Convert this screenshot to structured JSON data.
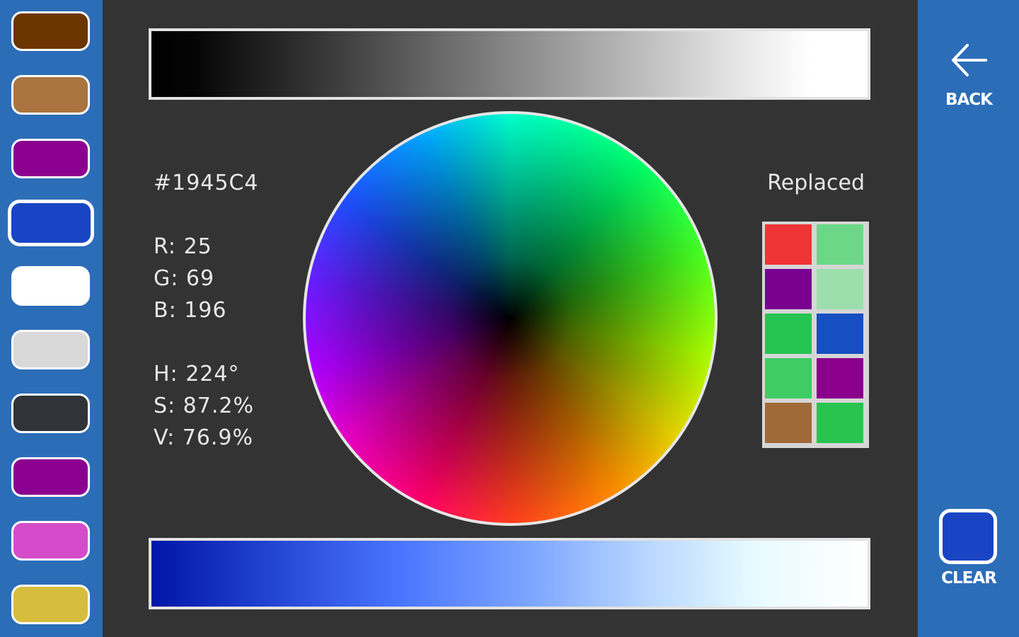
{
  "palette": {
    "swatches": [
      {
        "color": "#6b3500",
        "selected": false
      },
      {
        "color": "#a9743f",
        "selected": false
      },
      {
        "color": "#8b008f",
        "selected": false
      },
      {
        "color": "#1945c4",
        "selected": true
      },
      {
        "color": "#ffffff",
        "selected": false
      },
      {
        "color": "#d8d8d8",
        "selected": false
      },
      {
        "color": "#303438",
        "selected": false
      },
      {
        "color": "#8b008f",
        "selected": false
      },
      {
        "color": "#d44cc9",
        "selected": false
      },
      {
        "color": "#d6bd3e",
        "selected": false
      }
    ]
  },
  "color_info": {
    "hex": "#1945C4",
    "r": "R: 25",
    "g": "G: 69",
    "b": "B: 196",
    "h": "H: 224°",
    "s": "S: 87.2%",
    "v": "V: 76.9%"
  },
  "replaced": {
    "label": "Replaced",
    "cells": [
      "#ee3434",
      "#6cd887",
      "#7a0090",
      "#9cdfac",
      "#25c451",
      "#164fc2",
      "#3fcc63",
      "#8a008d",
      "#a06a38",
      "#29c450"
    ]
  },
  "actions": {
    "back_label": "BACK",
    "clear_label": "CLEAR",
    "clear_color": "#1945c4"
  },
  "colors": {
    "sidebar": "#2c6db8",
    "background": "#333333"
  }
}
